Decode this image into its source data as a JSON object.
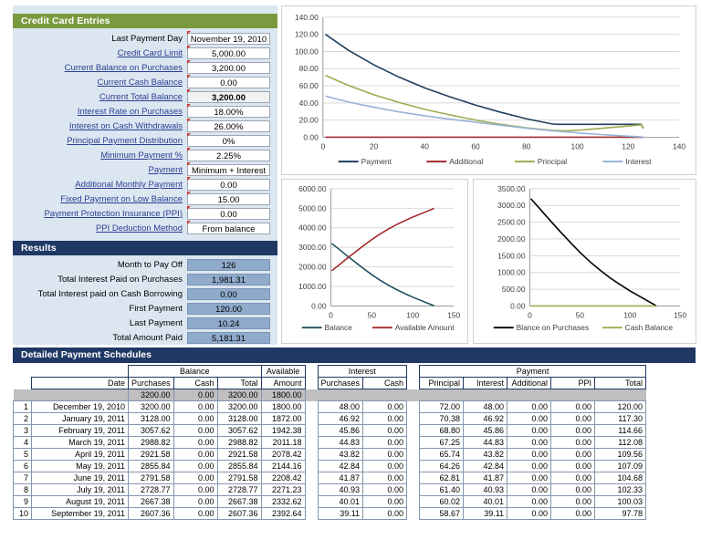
{
  "entries": {
    "title": "Credit Card Entries",
    "accent": "#7a9a3f",
    "rows": [
      {
        "label": "Last Payment Day",
        "value": "November 19, 2010",
        "link": false,
        "bold": false
      },
      {
        "label": "Credit Card Limit",
        "value": "5,000.00",
        "link": true,
        "bold": false
      },
      {
        "label": "Current Balance on Purchases",
        "value": "3,200.00",
        "link": true,
        "bold": false
      },
      {
        "label": "Current Cash Balance",
        "value": "0.00",
        "link": true,
        "bold": false
      },
      {
        "label": "Current Total Balance",
        "value": "3,200.00",
        "link": true,
        "bold": true
      },
      {
        "label": "Interest Rate on Purchases",
        "value": "18.00%",
        "link": true,
        "bold": false
      },
      {
        "label": "Interest on Cash Withdrawals",
        "value": "26.00%",
        "link": true,
        "bold": false
      },
      {
        "label": "Principal Payment Distribution",
        "value": "0%",
        "link": true,
        "bold": false
      },
      {
        "label": "Minimum Payment %",
        "value": "2.25%",
        "link": true,
        "bold": false
      },
      {
        "label": "Payment",
        "value": "Minimum + Interest",
        "link": true,
        "bold": false
      },
      {
        "label": "Additional Monthly Payment",
        "value": "0.00",
        "link": true,
        "bold": false
      },
      {
        "label": "Fixed Payment on Low Balance",
        "value": "15.00",
        "link": true,
        "bold": false
      },
      {
        "label": "Payment Protection Insurance (PPI)",
        "value": "0.00",
        "link": true,
        "bold": false
      },
      {
        "label": "PPI Deduction Method",
        "value": "From balance",
        "link": true,
        "bold": false
      }
    ]
  },
  "results": {
    "title": "Results",
    "accent": "#1f3864",
    "rows": [
      {
        "label": "Month to Pay Off",
        "value": "126"
      },
      {
        "label": "Total Interest Paid on Purchases",
        "value": "1,981.31"
      },
      {
        "label": "Total Interest paid on Cash Borrowing",
        "value": "0.00"
      },
      {
        "label": "First Payment",
        "value": "120.00"
      },
      {
        "label": "Last Payment",
        "value": "10.24"
      },
      {
        "label": "Total Amount Paid",
        "value": "5,181.31"
      }
    ]
  },
  "schedule": {
    "title": "Detailed Payment Schedules",
    "group_headers": {
      "balance": "Balance",
      "available": "Available",
      "interest": "Interest",
      "payment": "Payment"
    },
    "columns": {
      "date": "Date",
      "bal_purchases": "Purchases",
      "bal_cash": "Cash",
      "bal_total": "Total",
      "avail_amount": "Amount",
      "int_purchases": "Purchases",
      "int_cash": "Cash",
      "pay_principal": "Principal",
      "pay_interest": "Interest",
      "pay_additional": "Additional",
      "pay_ppi": "PPI",
      "pay_total": "Total"
    },
    "summary_row": {
      "bal_purchases": "3200.00",
      "bal_cash": "0.00",
      "bal_total": "3200.00",
      "avail_amount": "1800.00"
    },
    "rows": [
      {
        "n": "1",
        "date": "December 19, 2010",
        "bp": "3200.00",
        "bc": "0.00",
        "bt": "3200.00",
        "av": "1800.00",
        "ip": "48.00",
        "ic": "0.00",
        "pp": "72.00",
        "pi": "48.00",
        "pa": "0.00",
        "ppi": "0.00",
        "pt": "120.00"
      },
      {
        "n": "2",
        "date": "January 19, 2011",
        "bp": "3128.00",
        "bc": "0.00",
        "bt": "3128.00",
        "av": "1872.00",
        "ip": "46.92",
        "ic": "0.00",
        "pp": "70.38",
        "pi": "46.92",
        "pa": "0.00",
        "ppi": "0.00",
        "pt": "117.30"
      },
      {
        "n": "3",
        "date": "February 19, 2011",
        "bp": "3057.62",
        "bc": "0.00",
        "bt": "3057.62",
        "av": "1942.38",
        "ip": "45.86",
        "ic": "0.00",
        "pp": "68.80",
        "pi": "45.86",
        "pa": "0.00",
        "ppi": "0.00",
        "pt": "114.66"
      },
      {
        "n": "4",
        "date": "March 19, 2011",
        "bp": "2988.82",
        "bc": "0.00",
        "bt": "2988.82",
        "av": "2011.18",
        "ip": "44.83",
        "ic": "0.00",
        "pp": "67.25",
        "pi": "44.83",
        "pa": "0.00",
        "ppi": "0.00",
        "pt": "112.08"
      },
      {
        "n": "5",
        "date": "April 19, 2011",
        "bp": "2921.58",
        "bc": "0.00",
        "bt": "2921.58",
        "av": "2078.42",
        "ip": "43.82",
        "ic": "0.00",
        "pp": "65.74",
        "pi": "43.82",
        "pa": "0.00",
        "ppi": "0.00",
        "pt": "109.56"
      },
      {
        "n": "6",
        "date": "May 19, 2011",
        "bp": "2855.84",
        "bc": "0.00",
        "bt": "2855.84",
        "av": "2144.16",
        "ip": "42.84",
        "ic": "0.00",
        "pp": "64.26",
        "pi": "42.84",
        "pa": "0.00",
        "ppi": "0.00",
        "pt": "107.09"
      },
      {
        "n": "7",
        "date": "June 19, 2011",
        "bp": "2791.58",
        "bc": "0.00",
        "bt": "2791.58",
        "av": "2208.42",
        "ip": "41.87",
        "ic": "0.00",
        "pp": "62.81",
        "pi": "41.87",
        "pa": "0.00",
        "ppi": "0.00",
        "pt": "104.68"
      },
      {
        "n": "8",
        "date": "July 19, 2011",
        "bp": "2728.77",
        "bc": "0.00",
        "bt": "2728.77",
        "av": "2271.23",
        "ip": "40.93",
        "ic": "0.00",
        "pp": "61.40",
        "pi": "40.93",
        "pa": "0.00",
        "ppi": "0.00",
        "pt": "102.33"
      },
      {
        "n": "9",
        "date": "August 19, 2011",
        "bp": "2667.38",
        "bc": "0.00",
        "bt": "2667.38",
        "av": "2332.62",
        "ip": "40.01",
        "ic": "0.00",
        "pp": "60.02",
        "pi": "40.01",
        "pa": "0.00",
        "ppi": "0.00",
        "pt": "100.03"
      },
      {
        "n": "10",
        "date": "September 19, 2011",
        "bp": "2607.36",
        "bc": "0.00",
        "bt": "2607.36",
        "av": "2392.64",
        "ip": "39.11",
        "ic": "0.00",
        "pp": "58.67",
        "pi": "39.11",
        "pa": "0.00",
        "ppi": "0.00",
        "pt": "97.78"
      }
    ]
  },
  "chart_data": [
    {
      "id": "payment-breakdown",
      "type": "line",
      "title": "",
      "xlabel": "",
      "ylabel": "",
      "xlim": [
        0,
        140
      ],
      "ylim": [
        0,
        140
      ],
      "xticks": [
        0,
        20,
        40,
        60,
        80,
        100,
        120,
        140
      ],
      "yticks": [
        "0.00",
        "20.00",
        "40.00",
        "60.00",
        "80.00",
        "100.00",
        "120.00",
        "140.00"
      ],
      "grid": true,
      "legend_position": "bottom",
      "series": [
        {
          "name": "Payment",
          "color": "#1f3f5e",
          "x": [
            1,
            10,
            20,
            30,
            40,
            50,
            60,
            70,
            80,
            90,
            92,
            100,
            110,
            120,
            125,
            126
          ],
          "values": [
            120.0,
            101.5,
            84.5,
            70.0,
            57.5,
            47.0,
            37.5,
            29.0,
            21.5,
            15.5,
            15.0,
            15.0,
            15.0,
            15.0,
            15.0,
            10.24
          ]
        },
        {
          "name": "Additional",
          "color": "#a5282c",
          "x": [
            1,
            126
          ],
          "values": [
            0,
            0
          ]
        },
        {
          "name": "Principal",
          "color": "#9bab4f",
          "x": [
            1,
            10,
            20,
            30,
            40,
            50,
            60,
            70,
            80,
            90,
            95,
            100,
            110,
            120,
            125,
            126
          ],
          "values": [
            72.0,
            60.5,
            49.5,
            40.5,
            32.5,
            26.0,
            20.0,
            15.0,
            11.0,
            8.0,
            7.5,
            8.0,
            10.5,
            13.0,
            14.5,
            10.24
          ]
        },
        {
          "name": "Interest",
          "color": "#95b3d7",
          "x": [
            1,
            10,
            20,
            30,
            40,
            50,
            60,
            70,
            80,
            90,
            100,
            110,
            120,
            125,
            126
          ],
          "values": [
            48.0,
            41.0,
            35.0,
            29.5,
            25.0,
            21.0,
            17.5,
            14.0,
            10.5,
            7.5,
            5.0,
            3.0,
            1.2,
            0.4,
            0.0
          ]
        }
      ]
    },
    {
      "id": "balance-vs-available",
      "type": "line",
      "title": "",
      "xlabel": "",
      "ylabel": "",
      "xlim": [
        0,
        150
      ],
      "ylim": [
        0,
        6000
      ],
      "xticks": [
        0,
        50,
        100,
        150
      ],
      "yticks": [
        "0.00",
        "1000.00",
        "2000.00",
        "3000.00",
        "4000.00",
        "5000.00",
        "6000.00"
      ],
      "grid": true,
      "legend_position": "bottom",
      "series": [
        {
          "name": "Balance",
          "color": "#1f4e5f",
          "x": [
            1,
            10,
            20,
            30,
            40,
            50,
            60,
            70,
            80,
            90,
            100,
            110,
            120,
            126
          ],
          "values": [
            3200,
            2900,
            2560,
            2230,
            1910,
            1600,
            1320,
            1070,
            840,
            640,
            450,
            280,
            110,
            10
          ]
        },
        {
          "name": "Available Amount",
          "color": "#a5282c",
          "x": [
            1,
            10,
            20,
            30,
            40,
            50,
            60,
            70,
            80,
            90,
            100,
            110,
            120,
            126
          ],
          "values": [
            1800,
            2100,
            2440,
            2770,
            3090,
            3400,
            3680,
            3930,
            4160,
            4360,
            4550,
            4720,
            4890,
            4990
          ]
        }
      ]
    },
    {
      "id": "balance-on-purchases",
      "type": "line",
      "title": "",
      "xlabel": "",
      "ylabel": "",
      "xlim": [
        0,
        150
      ],
      "ylim": [
        0,
        3500
      ],
      "xticks": [
        0,
        50,
        100,
        150
      ],
      "yticks": [
        "0.00",
        "500.00",
        "1000.00",
        "1500.00",
        "2000.00",
        "2500.00",
        "3000.00",
        "3500.00"
      ],
      "grid": true,
      "legend_position": "bottom",
      "series": [
        {
          "name": "Blance on Purchases",
          "color": "#000000",
          "x": [
            1,
            10,
            20,
            30,
            40,
            50,
            60,
            70,
            80,
            90,
            100,
            110,
            120,
            126
          ],
          "values": [
            3200,
            2900,
            2560,
            2230,
            1910,
            1600,
            1320,
            1070,
            840,
            640,
            450,
            280,
            110,
            10
          ]
        },
        {
          "name": "Cash Balance",
          "color": "#9bab4f",
          "x": [
            1,
            126
          ],
          "values": [
            0,
            0
          ]
        }
      ]
    }
  ]
}
